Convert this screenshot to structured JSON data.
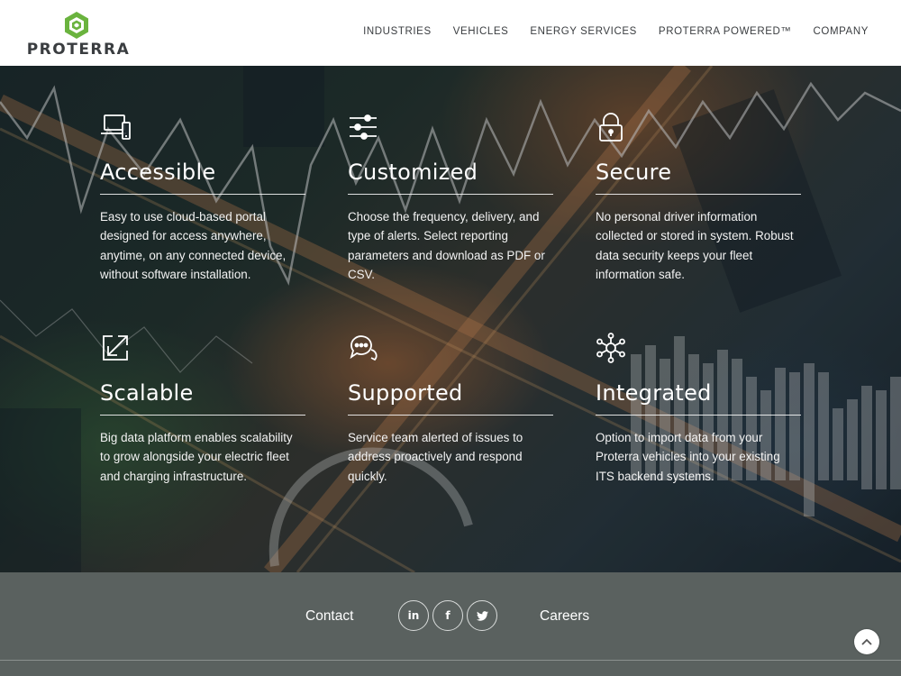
{
  "brand": {
    "name": "PROTERRA",
    "accent": "#6ab33e",
    "text_color": "#3a3d40"
  },
  "nav": {
    "items": [
      {
        "label": "INDUSTRIES"
      },
      {
        "label": "VEHICLES"
      },
      {
        "label": "ENERGY SERVICES"
      },
      {
        "label": "PROTERRA POWERED™"
      },
      {
        "label": "COMPANY"
      }
    ]
  },
  "features": [
    {
      "icon": "devices-icon",
      "title": "Accessible",
      "text": "Easy to use cloud-based portal designed for access anywhere, anytime, on any connected device, without software installation."
    },
    {
      "icon": "sliders-icon",
      "title": "Customized",
      "text": "Choose the frequency, delivery, and type of alerts. Select reporting parameters and download as PDF or CSV."
    },
    {
      "icon": "lock-icon",
      "title": "Secure",
      "text": "No personal driver information collected or stored in system. Robust data security keeps your fleet information safe."
    },
    {
      "icon": "expand-icon",
      "title": "Scalable",
      "text": "Big data platform enables scalability to grow alongside your electric fleet and charging infrastructure."
    },
    {
      "icon": "chat-icon",
      "title": "Supported",
      "text": "Service team alerted of issues to address proactively and respond quickly."
    },
    {
      "icon": "network-icon",
      "title": "Integrated",
      "text": "Option to import data from your Proterra vehicles into your existing ITS backend systems."
    }
  ],
  "footer": {
    "contact_label": "Contact",
    "careers_label": "Careers",
    "social": [
      {
        "icon": "linkedin-icon",
        "glyph": "in"
      },
      {
        "icon": "facebook-icon",
        "glyph": "f"
      },
      {
        "icon": "twitter-icon",
        "glyph": "t"
      }
    ],
    "background": "#5a615f"
  }
}
